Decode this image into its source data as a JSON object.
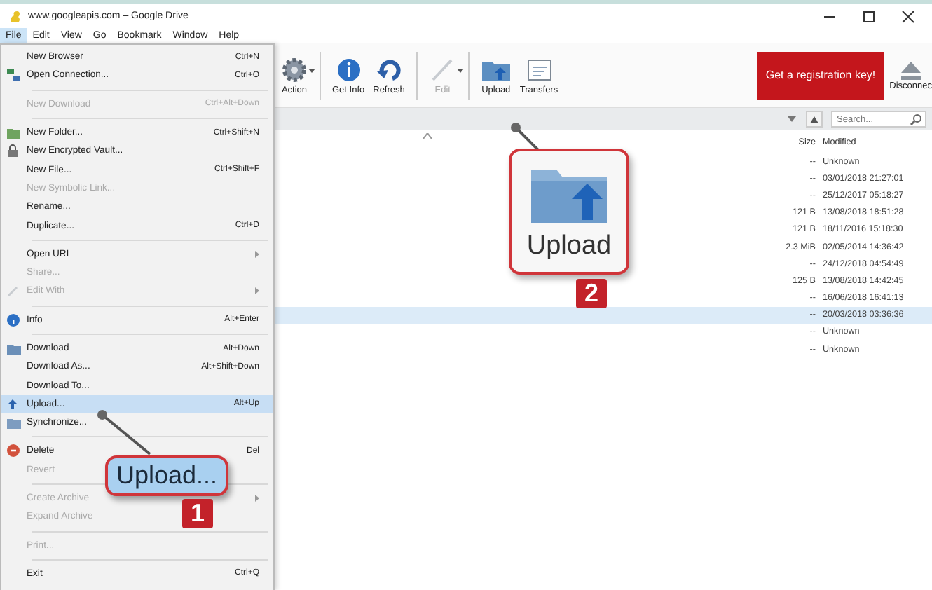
{
  "window": {
    "title": "www.googleapis.com – Google Drive"
  },
  "menubar": [
    {
      "label": "File",
      "selected": true
    },
    {
      "label": "Edit",
      "selected": false
    },
    {
      "label": "View",
      "selected": false
    },
    {
      "label": "Go",
      "selected": false
    },
    {
      "label": "Bookmark",
      "selected": false
    },
    {
      "label": "Window",
      "selected": false
    },
    {
      "label": "Help",
      "selected": false
    }
  ],
  "toolbar": [
    {
      "label": "Action",
      "dropdown": true,
      "disabled": false
    },
    {
      "label": "Get Info",
      "dropdown": false,
      "disabled": false
    },
    {
      "label": "Refresh",
      "dropdown": false,
      "disabled": false
    },
    {
      "label": "Edit",
      "dropdown": true,
      "disabled": true
    },
    {
      "label": "Upload",
      "dropdown": false,
      "disabled": false
    },
    {
      "label": "Transfers",
      "dropdown": false,
      "disabled": false
    }
  ],
  "registration_button": "Get a registration key!",
  "disconnect_button": "Disconnec",
  "search": {
    "placeholder": "Search..."
  },
  "columns": [
    "Size",
    "Modified"
  ],
  "rows": [
    {
      "size": "--",
      "modified": "Unknown",
      "selected": false
    },
    {
      "size": "--",
      "modified": "03/01/2018 21:27:01",
      "selected": false
    },
    {
      "size": "--",
      "modified": "25/12/2017 05:18:27",
      "selected": false
    },
    {
      "size": "121 B",
      "modified": "13/08/2018 18:51:28",
      "selected": false
    },
    {
      "size": "121 B",
      "modified": "18/11/2016 15:18:30",
      "selected": false
    },
    {
      "size": "2.3 MiB",
      "modified": "02/05/2014 14:36:42",
      "selected": false
    },
    {
      "size": "--",
      "modified": "24/12/2018 04:54:49",
      "selected": false
    },
    {
      "size": "125 B",
      "modified": "13/08/2018 14:42:45",
      "selected": false
    },
    {
      "size": "--",
      "modified": "16/06/2018 16:41:13",
      "selected": false
    },
    {
      "size": "--",
      "modified": "20/03/2018 03:36:36",
      "selected": true
    },
    {
      "size": "--",
      "modified": "Unknown",
      "selected": false
    },
    {
      "size": "--",
      "modified": "Unknown",
      "selected": false
    }
  ],
  "file_menu": [
    {
      "kind": "item",
      "label": "New Browser",
      "shortcut": "Ctrl+N",
      "disabled": false,
      "selected": false
    },
    {
      "kind": "item",
      "label": "Open Connection...",
      "shortcut": "Ctrl+O",
      "disabled": false,
      "selected": false
    },
    {
      "kind": "separator"
    },
    {
      "kind": "item",
      "label": "New Download",
      "shortcut": "Ctrl+Alt+Down",
      "disabled": true,
      "selected": false
    },
    {
      "kind": "separator"
    },
    {
      "kind": "item",
      "label": "New Folder...",
      "shortcut": "Ctrl+Shift+N",
      "disabled": false,
      "selected": false
    },
    {
      "kind": "item",
      "label": "New Encrypted Vault...",
      "disabled": false,
      "selected": false
    },
    {
      "kind": "item",
      "label": "New File...",
      "shortcut": "Ctrl+Shift+F",
      "disabled": false,
      "selected": false
    },
    {
      "kind": "item",
      "label": "New Symbolic Link...",
      "disabled": true,
      "selected": false
    },
    {
      "kind": "item",
      "label": "Rename...",
      "disabled": false,
      "selected": false
    },
    {
      "kind": "item",
      "label": "Duplicate...",
      "shortcut": "Ctrl+D",
      "disabled": false,
      "selected": false
    },
    {
      "kind": "separator"
    },
    {
      "kind": "item",
      "label": "Open URL",
      "submenu": true,
      "disabled": false,
      "selected": false
    },
    {
      "kind": "item",
      "label": "Share...",
      "disabled": true,
      "selected": false
    },
    {
      "kind": "item",
      "label": "Edit With",
      "submenu": true,
      "disabled": true,
      "selected": false
    },
    {
      "kind": "separator"
    },
    {
      "kind": "item",
      "label": "Info",
      "shortcut": "Alt+Enter",
      "disabled": false,
      "selected": false
    },
    {
      "kind": "separator"
    },
    {
      "kind": "item",
      "label": "Download",
      "shortcut": "Alt+Down",
      "disabled": false,
      "selected": false
    },
    {
      "kind": "item",
      "label": "Download As...",
      "shortcut": "Alt+Shift+Down",
      "disabled": false,
      "selected": false
    },
    {
      "kind": "item",
      "label": "Download To...",
      "disabled": false,
      "selected": false
    },
    {
      "kind": "item",
      "label": "Upload...",
      "shortcut": "Alt+Up",
      "disabled": false,
      "selected": true
    },
    {
      "kind": "item",
      "label": "Synchronize...",
      "disabled": false,
      "selected": false
    },
    {
      "kind": "separator"
    },
    {
      "kind": "item",
      "label": "Delete",
      "shortcut": "Del",
      "disabled": false,
      "selected": false
    },
    {
      "kind": "item",
      "label": "Revert",
      "disabled": true,
      "selected": false
    },
    {
      "kind": "separator"
    },
    {
      "kind": "item",
      "label": "Create Archive",
      "submenu": true,
      "disabled": true,
      "selected": false
    },
    {
      "kind": "item",
      "label": "Expand Archive",
      "disabled": true,
      "selected": false
    },
    {
      "kind": "separator"
    },
    {
      "kind": "item",
      "label": "Print...",
      "disabled": true,
      "selected": false
    },
    {
      "kind": "separator"
    },
    {
      "kind": "item",
      "label": "Exit",
      "shortcut": "Ctrl+Q",
      "disabled": false,
      "selected": false
    }
  ],
  "callouts": [
    {
      "label": "Upload...",
      "number": "1",
      "kind": "menu"
    },
    {
      "label": "Upload",
      "number": "2",
      "kind": "toolbar"
    }
  ]
}
